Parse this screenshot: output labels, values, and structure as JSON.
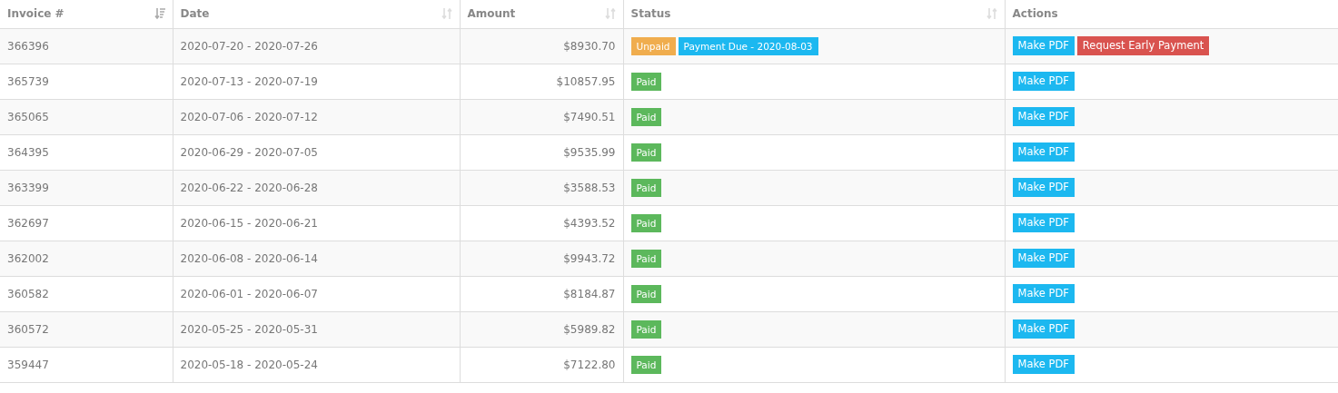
{
  "table": {
    "columns": [
      {
        "label": "Invoice #",
        "sorted": true
      },
      {
        "label": "Date",
        "sorted": false
      },
      {
        "label": "Amount",
        "sorted": false
      },
      {
        "label": "Status",
        "sorted": false
      },
      {
        "label": "Actions"
      }
    ],
    "rows": [
      {
        "invoice": "366396",
        "date": "2020-07-20 - 2020-07-26",
        "amount": "$8930.70",
        "status": [
          {
            "kind": "unpaid",
            "label": "Unpaid"
          },
          {
            "kind": "due",
            "label": "Payment Due - 2020-08-03"
          }
        ],
        "actions": [
          {
            "kind": "pdf",
            "label": "Make PDF"
          },
          {
            "kind": "early",
            "label": "Request Early Payment"
          }
        ]
      },
      {
        "invoice": "365739",
        "date": "2020-07-13 - 2020-07-19",
        "amount": "$10857.95",
        "status": [
          {
            "kind": "paid",
            "label": "Paid"
          }
        ],
        "actions": [
          {
            "kind": "pdf",
            "label": "Make PDF"
          }
        ]
      },
      {
        "invoice": "365065",
        "date": "2020-07-06 - 2020-07-12",
        "amount": "$7490.51",
        "status": [
          {
            "kind": "paid",
            "label": "Paid"
          }
        ],
        "actions": [
          {
            "kind": "pdf",
            "label": "Make PDF"
          }
        ]
      },
      {
        "invoice": "364395",
        "date": "2020-06-29 - 2020-07-05",
        "amount": "$9535.99",
        "status": [
          {
            "kind": "paid",
            "label": "Paid"
          }
        ],
        "actions": [
          {
            "kind": "pdf",
            "label": "Make PDF"
          }
        ]
      },
      {
        "invoice": "363399",
        "date": "2020-06-22 - 2020-06-28",
        "amount": "$3588.53",
        "status": [
          {
            "kind": "paid",
            "label": "Paid"
          }
        ],
        "actions": [
          {
            "kind": "pdf",
            "label": "Make PDF"
          }
        ]
      },
      {
        "invoice": "362697",
        "date": "2020-06-15 - 2020-06-21",
        "amount": "$4393.52",
        "status": [
          {
            "kind": "paid",
            "label": "Paid"
          }
        ],
        "actions": [
          {
            "kind": "pdf",
            "label": "Make PDF"
          }
        ]
      },
      {
        "invoice": "362002",
        "date": "2020-06-08 - 2020-06-14",
        "amount": "$9943.72",
        "status": [
          {
            "kind": "paid",
            "label": "Paid"
          }
        ],
        "actions": [
          {
            "kind": "pdf",
            "label": "Make PDF"
          }
        ]
      },
      {
        "invoice": "360582",
        "date": "2020-06-01 - 2020-06-07",
        "amount": "$8184.87",
        "status": [
          {
            "kind": "paid",
            "label": "Paid"
          }
        ],
        "actions": [
          {
            "kind": "pdf",
            "label": "Make PDF"
          }
        ]
      },
      {
        "invoice": "360572",
        "date": "2020-05-25 - 2020-05-31",
        "amount": "$5989.82",
        "status": [
          {
            "kind": "paid",
            "label": "Paid"
          }
        ],
        "actions": [
          {
            "kind": "pdf",
            "label": "Make PDF"
          }
        ]
      },
      {
        "invoice": "359447",
        "date": "2020-05-18 - 2020-05-24",
        "amount": "$7122.80",
        "status": [
          {
            "kind": "paid",
            "label": "Paid"
          }
        ],
        "actions": [
          {
            "kind": "pdf",
            "label": "Make PDF"
          }
        ]
      }
    ]
  }
}
